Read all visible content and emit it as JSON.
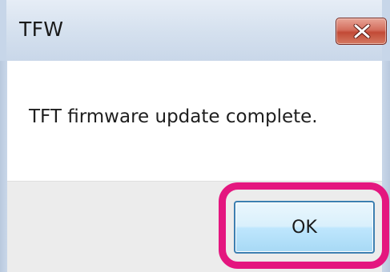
{
  "window": {
    "title": "TFW",
    "message": "TFT firmware update complete.",
    "ok_label": "OK"
  },
  "icons": {
    "close": "close-icon"
  },
  "colors": {
    "highlight": "#e4167f",
    "close_button": "#c24a36",
    "ok_button_border": "#3c7fb1",
    "footer_background": "#ececec",
    "titlebar": "#d4e0ee"
  }
}
